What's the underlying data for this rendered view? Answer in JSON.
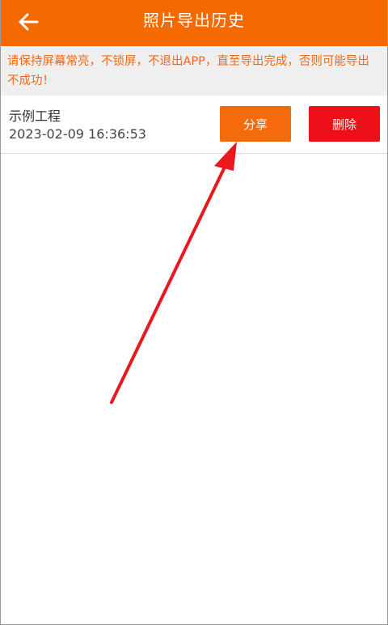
{
  "header": {
    "title": "照片导出历史",
    "back_icon": "arrow-left-icon"
  },
  "notice": {
    "text": "请保持屏幕常亮，不锁屏，不退出APP，直至导出完成，否则可能导出不成功！"
  },
  "history": {
    "items": [
      {
        "name": "示例工程",
        "time": "2023-02-09 16:36:53",
        "share_label": "分享",
        "delete_label": "删除"
      }
    ]
  },
  "colors": {
    "header_bg": "#f56a00",
    "notice_text": "#ef6a16",
    "share_bg": "#f56a0a",
    "delete_bg": "#ee1018",
    "annotation_arrow": "#e8181e"
  }
}
